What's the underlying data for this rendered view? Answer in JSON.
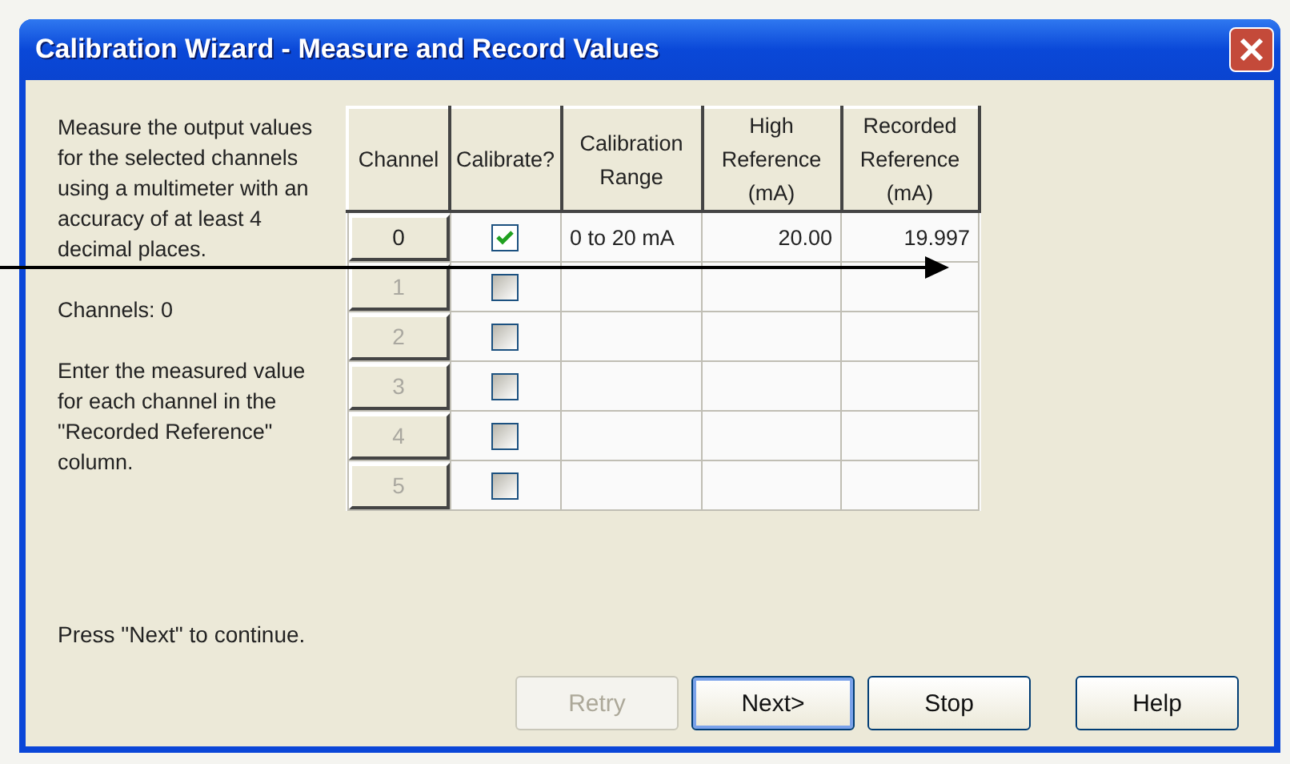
{
  "window": {
    "title": "Calibration Wizard - Measure and Record Values"
  },
  "instructions": [
    "Measure the output values for the selected channels using a multimeter with an accuracy of at least 4 decimal  places.",
    "Channels: 0",
    "Enter the measured value for each channel in the \"Recorded Reference\" column."
  ],
  "footer_text": "Press \"Next\" to continue.",
  "table": {
    "columns": [
      "Channel",
      "Calibrate?",
      "Calibration Range",
      "High Reference (mA)",
      "Recorded Reference (mA)"
    ],
    "rows": [
      {
        "channel": "0",
        "disabled": false,
        "checked": true,
        "range": "0 to 20 mA",
        "high": "20.00",
        "recorded": "19.997"
      },
      {
        "channel": "1",
        "disabled": true,
        "checked": false
      },
      {
        "channel": "2",
        "disabled": true,
        "checked": false
      },
      {
        "channel": "3",
        "disabled": true,
        "checked": false
      },
      {
        "channel": "4",
        "disabled": true,
        "checked": false
      },
      {
        "channel": "5",
        "disabled": true,
        "checked": false
      }
    ]
  },
  "buttons": [
    {
      "label": "Retry",
      "disabled": true,
      "default": false
    },
    {
      "label": "Next>",
      "disabled": false,
      "default": true
    },
    {
      "label": "Stop",
      "disabled": false,
      "default": false
    },
    {
      "label": "Help",
      "disabled": false,
      "default": false
    }
  ]
}
